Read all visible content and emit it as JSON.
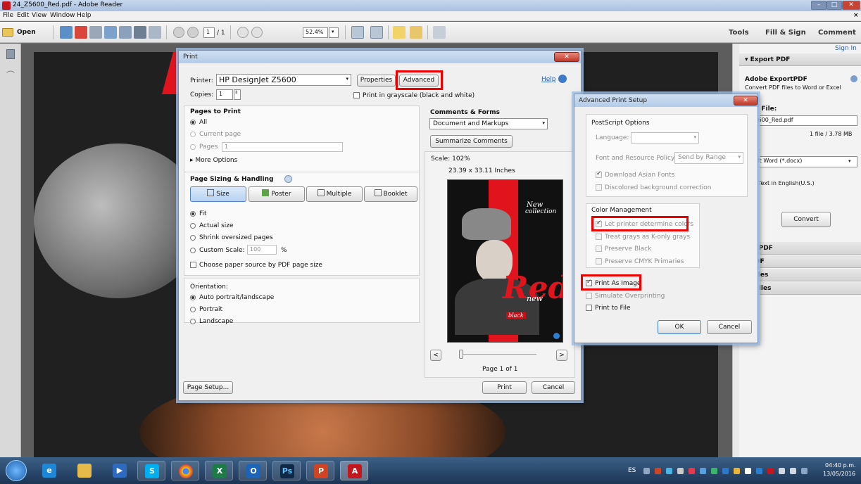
{
  "window": {
    "title": "24_Z5600_Red.pdf - Adobe Reader"
  },
  "menu": [
    "File",
    "Edit",
    "View",
    "Window",
    "Help"
  ],
  "toolbar": {
    "open_label": "Open",
    "page_current": "1",
    "page_total": "/ 1",
    "zoom": "52.4%",
    "tools": "Tools",
    "fill_sign": "Fill & Sign",
    "comment": "Comment"
  },
  "rightpane": {
    "sign_in": "Sign In",
    "export_header": "▾ Export PDF",
    "export_title": "Adobe ExportPDF",
    "export_desc": "Convert PDF files to Word or Excel",
    "pdf_file_label": "PDF File:",
    "pdf_file": "_Z5600_Red.pdf",
    "file_count": "1 file / 3.78 MB",
    "convert_to_label": "rt To:",
    "convert_to": "osoft Word (*.docx)",
    "recognize": "nize Text in English(U.S.)",
    "recognize2": "e",
    "convert_btn": "Convert",
    "sections": [
      "ate PDF",
      "t PDF",
      "d Files",
      "re Files"
    ]
  },
  "print": {
    "title": "Print",
    "printer_label": "Printer:",
    "printer": "HP DesignJet Z5600",
    "properties": "Properties",
    "advanced": "Advanced",
    "help": "Help",
    "copies_label": "Copies:",
    "copies": "1",
    "grayscale": "Print in grayscale (black and white)",
    "pages_header": "Pages to Print",
    "all": "All",
    "current_page": "Current page",
    "pages": "Pages",
    "pages_value": "1",
    "more_options": "More Options",
    "sizing_header": "Page Sizing & Handling",
    "size_btn": "Size",
    "poster_btn": "Poster",
    "multiple_btn": "Multiple",
    "booklet_btn": "Booklet",
    "fit": "Fit",
    "actual_size": "Actual size",
    "shrink": "Shrink oversized pages",
    "custom_scale": "Custom Scale:",
    "custom_value": "100",
    "percent": "%",
    "paper_source": "Choose paper source by PDF page size",
    "orientation_header": "Orientation:",
    "auto": "Auto portrait/landscape",
    "portrait": "Portrait",
    "landscape": "Landscape",
    "comments_header": "Comments & Forms",
    "comments_select": "Document and Markups",
    "summarize": "Summarize Comments",
    "scale": "Scale: 102%",
    "dimensions": "23.39 x 33.11 Inches",
    "page_of": "Page 1 of 1",
    "page_setup": "Page Setup...",
    "print_btn": "Print",
    "cancel_btn": "Cancel",
    "preview_new": "New",
    "preview_collection": "collection",
    "preview_red": "Red",
    "preview_new2": "new",
    "preview_black": "black"
  },
  "advanced": {
    "title": "Advanced Print Setup",
    "ps_header": "PostScript Options",
    "language_label": "Language:",
    "font_policy_label": "Font and Resource Policy:",
    "font_policy": "Send by Range",
    "download_fonts": "Download Asian Fonts",
    "discolored": "Discolored background correction",
    "color_header": "Color Management",
    "let_printer": "Let printer determine colors",
    "treat_grays": "Treat grays as K-only grays",
    "preserve_black": "Preserve Black",
    "preserve_cmyk": "Preserve CMYK Primaries",
    "print_as_image": "Print As Image",
    "simulate": "Simulate Overprinting",
    "print_to_file": "Print to File",
    "ok": "OK",
    "cancel": "Cancel"
  },
  "taskbar": {
    "lang": "ES",
    "time": "04:40 p.m.",
    "date": "13/05/2016",
    "apps": [
      "ie-icon",
      "explorer-icon",
      "media-icon",
      "skype-icon",
      "chrome-icon",
      "excel-icon",
      "outlook-icon",
      "photoshop-icon",
      "powerpoint-icon",
      "acrobat-icon"
    ]
  }
}
